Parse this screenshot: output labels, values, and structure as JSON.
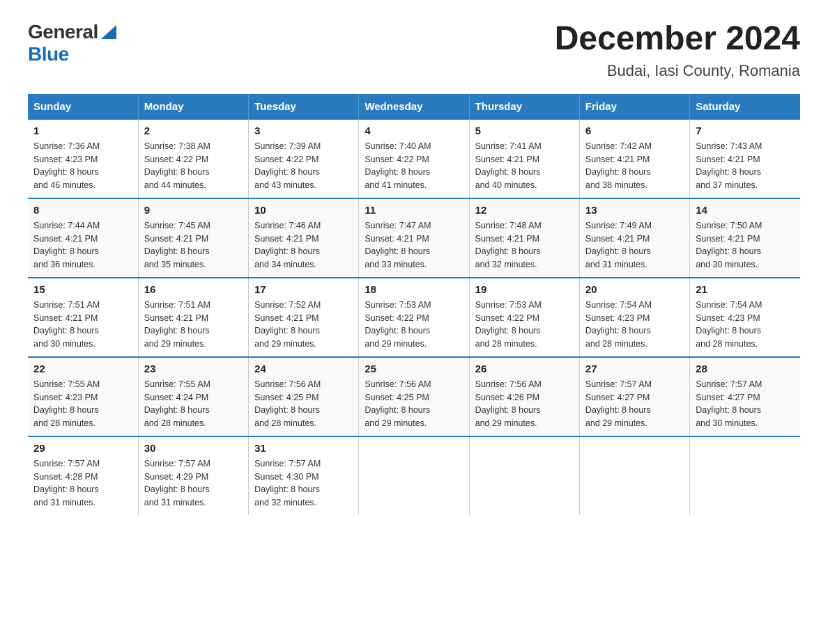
{
  "logo": {
    "general": "General",
    "blue": "Blue",
    "triangle_char": "▶"
  },
  "title": {
    "month": "December 2024",
    "location": "Budai, Iasi County, Romania"
  },
  "weekdays": [
    "Sunday",
    "Monday",
    "Tuesday",
    "Wednesday",
    "Thursday",
    "Friday",
    "Saturday"
  ],
  "weeks": [
    [
      {
        "day": "1",
        "sunrise": "7:36 AM",
        "sunset": "4:23 PM",
        "daylight": "8 hours and 46 minutes."
      },
      {
        "day": "2",
        "sunrise": "7:38 AM",
        "sunset": "4:22 PM",
        "daylight": "8 hours and 44 minutes."
      },
      {
        "day": "3",
        "sunrise": "7:39 AM",
        "sunset": "4:22 PM",
        "daylight": "8 hours and 43 minutes."
      },
      {
        "day": "4",
        "sunrise": "7:40 AM",
        "sunset": "4:22 PM",
        "daylight": "8 hours and 41 minutes."
      },
      {
        "day": "5",
        "sunrise": "7:41 AM",
        "sunset": "4:21 PM",
        "daylight": "8 hours and 40 minutes."
      },
      {
        "day": "6",
        "sunrise": "7:42 AM",
        "sunset": "4:21 PM",
        "daylight": "8 hours and 38 minutes."
      },
      {
        "day": "7",
        "sunrise": "7:43 AM",
        "sunset": "4:21 PM",
        "daylight": "8 hours and 37 minutes."
      }
    ],
    [
      {
        "day": "8",
        "sunrise": "7:44 AM",
        "sunset": "4:21 PM",
        "daylight": "8 hours and 36 minutes."
      },
      {
        "day": "9",
        "sunrise": "7:45 AM",
        "sunset": "4:21 PM",
        "daylight": "8 hours and 35 minutes."
      },
      {
        "day": "10",
        "sunrise": "7:46 AM",
        "sunset": "4:21 PM",
        "daylight": "8 hours and 34 minutes."
      },
      {
        "day": "11",
        "sunrise": "7:47 AM",
        "sunset": "4:21 PM",
        "daylight": "8 hours and 33 minutes."
      },
      {
        "day": "12",
        "sunrise": "7:48 AM",
        "sunset": "4:21 PM",
        "daylight": "8 hours and 32 minutes."
      },
      {
        "day": "13",
        "sunrise": "7:49 AM",
        "sunset": "4:21 PM",
        "daylight": "8 hours and 31 minutes."
      },
      {
        "day": "14",
        "sunrise": "7:50 AM",
        "sunset": "4:21 PM",
        "daylight": "8 hours and 30 minutes."
      }
    ],
    [
      {
        "day": "15",
        "sunrise": "7:51 AM",
        "sunset": "4:21 PM",
        "daylight": "8 hours and 30 minutes."
      },
      {
        "day": "16",
        "sunrise": "7:51 AM",
        "sunset": "4:21 PM",
        "daylight": "8 hours and 29 minutes."
      },
      {
        "day": "17",
        "sunrise": "7:52 AM",
        "sunset": "4:21 PM",
        "daylight": "8 hours and 29 minutes."
      },
      {
        "day": "18",
        "sunrise": "7:53 AM",
        "sunset": "4:22 PM",
        "daylight": "8 hours and 29 minutes."
      },
      {
        "day": "19",
        "sunrise": "7:53 AM",
        "sunset": "4:22 PM",
        "daylight": "8 hours and 28 minutes."
      },
      {
        "day": "20",
        "sunrise": "7:54 AM",
        "sunset": "4:23 PM",
        "daylight": "8 hours and 28 minutes."
      },
      {
        "day": "21",
        "sunrise": "7:54 AM",
        "sunset": "4:23 PM",
        "daylight": "8 hours and 28 minutes."
      }
    ],
    [
      {
        "day": "22",
        "sunrise": "7:55 AM",
        "sunset": "4:23 PM",
        "daylight": "8 hours and 28 minutes."
      },
      {
        "day": "23",
        "sunrise": "7:55 AM",
        "sunset": "4:24 PM",
        "daylight": "8 hours and 28 minutes."
      },
      {
        "day": "24",
        "sunrise": "7:56 AM",
        "sunset": "4:25 PM",
        "daylight": "8 hours and 28 minutes."
      },
      {
        "day": "25",
        "sunrise": "7:56 AM",
        "sunset": "4:25 PM",
        "daylight": "8 hours and 29 minutes."
      },
      {
        "day": "26",
        "sunrise": "7:56 AM",
        "sunset": "4:26 PM",
        "daylight": "8 hours and 29 minutes."
      },
      {
        "day": "27",
        "sunrise": "7:57 AM",
        "sunset": "4:27 PM",
        "daylight": "8 hours and 29 minutes."
      },
      {
        "day": "28",
        "sunrise": "7:57 AM",
        "sunset": "4:27 PM",
        "daylight": "8 hours and 30 minutes."
      }
    ],
    [
      {
        "day": "29",
        "sunrise": "7:57 AM",
        "sunset": "4:28 PM",
        "daylight": "8 hours and 31 minutes."
      },
      {
        "day": "30",
        "sunrise": "7:57 AM",
        "sunset": "4:29 PM",
        "daylight": "8 hours and 31 minutes."
      },
      {
        "day": "31",
        "sunrise": "7:57 AM",
        "sunset": "4:30 PM",
        "daylight": "8 hours and 32 minutes."
      },
      null,
      null,
      null,
      null
    ]
  ],
  "labels": {
    "sunrise": "Sunrise:",
    "sunset": "Sunset:",
    "daylight": "Daylight:"
  }
}
